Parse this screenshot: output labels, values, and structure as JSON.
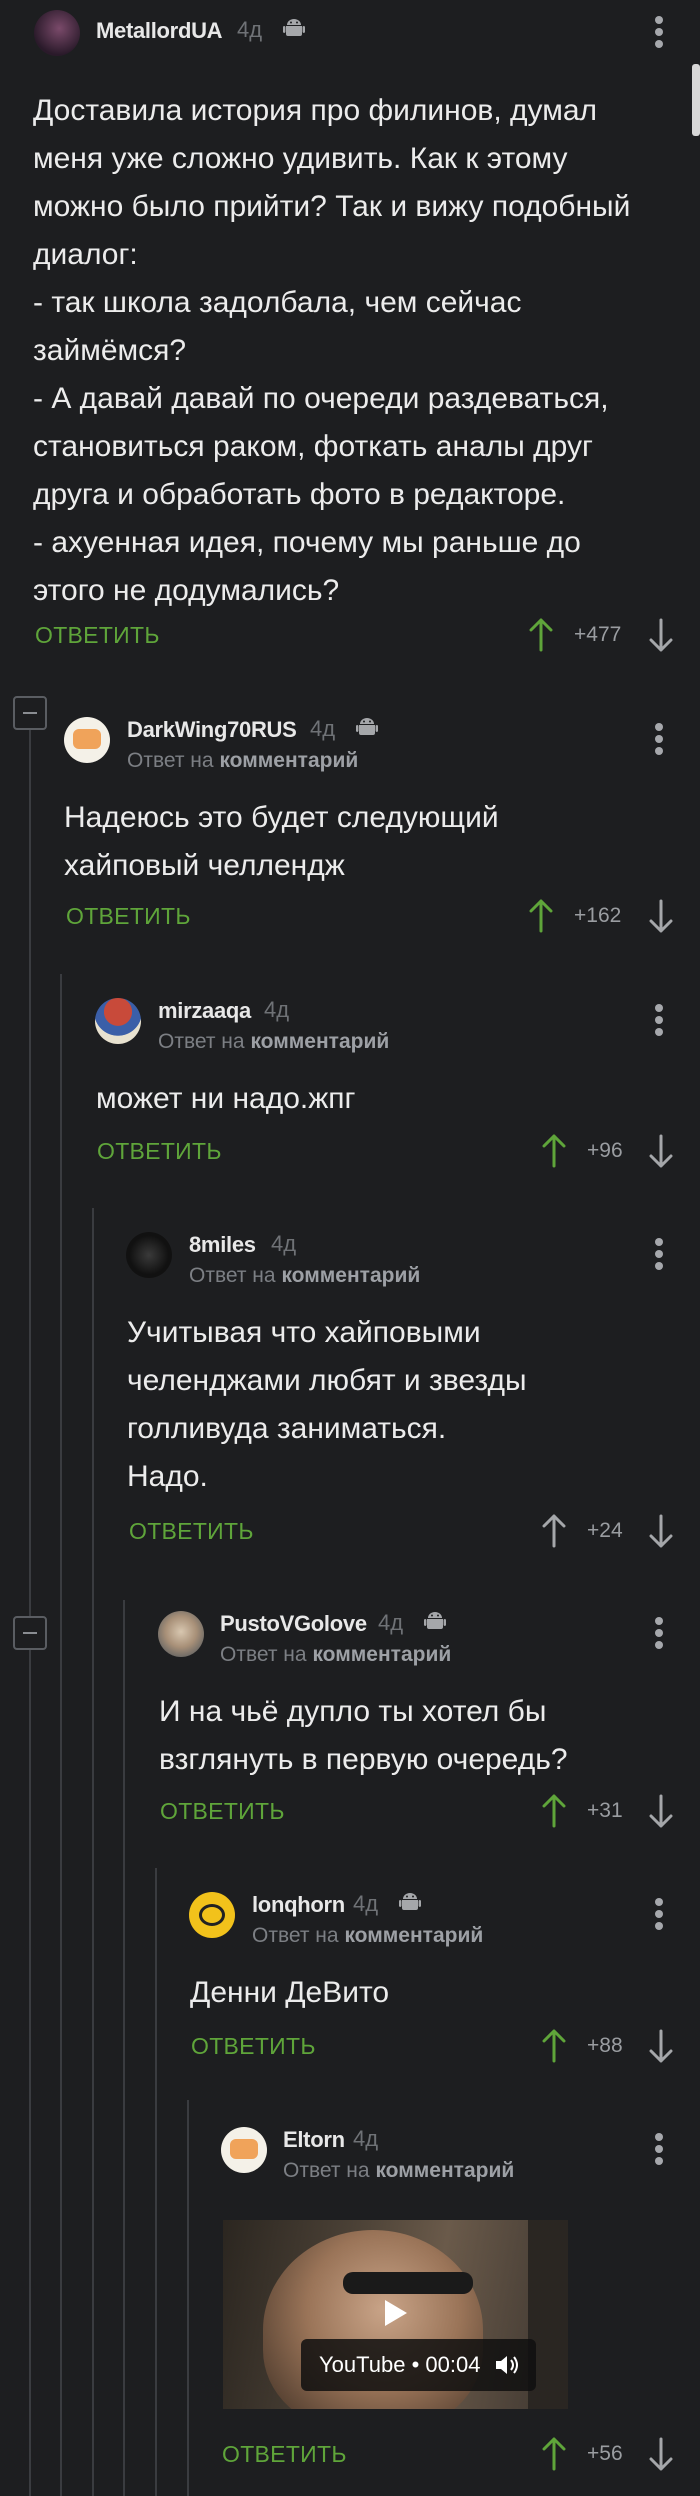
{
  "colors": {
    "background": "#1d1e20",
    "reply": "#5fa53a",
    "up": "#5fa53a",
    "text": "#ececec",
    "muted": "#7c7f84"
  },
  "comments": [
    {
      "nick": "MetallordUA",
      "time": "4д",
      "platform_icon": "android-icon",
      "text": "Доставила история про филинов, думал\nменя уже сложно удивить. Как к этому\nможно было прийти? Так и вижу подобный\nдиалог:\n- так школа задолбала, чем сейчас\nзаймёмся?\n- А давай давай по очереди раздеваться,\nстановиться раком, фоткать аналы друг\nдруга и обработать фото в редакторе.\n- ахуенная идея, почему мы раньше до\nэтого не додумались?",
      "reply": "ОТВЕТИТЬ",
      "rating": "+477"
    },
    {
      "nick": "DarkWing70RUS",
      "time": "4д",
      "platform_icon": "android-icon",
      "sub_prefix": "Ответ на",
      "sub_link": "комментарий",
      "text": "Надеюсь это будет следующий\nхайповый челлендж",
      "reply": "ОТВЕТИТЬ",
      "rating": "+162"
    },
    {
      "nick": "mirzaaqa",
      "time": "4д",
      "sub_prefix": "Ответ на",
      "sub_link": "комментарий",
      "text": "может ни надо.жпг",
      "reply": "ОТВЕТИТЬ",
      "rating": "+96"
    },
    {
      "nick": "8miles",
      "time": "4д",
      "sub_prefix": "Ответ на",
      "sub_link": "комментарий",
      "text": "Учитывая что хайповыми\nчеленджами любят и звезды\nголливуда заниматься.\nНадо.",
      "reply": "ОТВЕТИТЬ",
      "rating": "+24"
    },
    {
      "nick": "PustoVGolove",
      "time": "4д",
      "platform_icon": "android-icon",
      "sub_prefix": "Ответ на",
      "sub_link": "комментарий",
      "text": "И на чьё дупло ты хотел бы\nвзглянуть в первую очередь?",
      "reply": "ОТВЕТИТЬ",
      "rating": "+31"
    },
    {
      "nick": "lonqhorn",
      "time": "4д",
      "platform_icon": "android-icon",
      "sub_prefix": "Ответ на",
      "sub_link": "комментарий",
      "text": "Денни ДеВито",
      "reply": "ОТВЕТИТЬ",
      "rating": "+88"
    },
    {
      "nick": "Eltorn",
      "time": "4д",
      "sub_prefix": "Ответ на",
      "sub_link": "комментарий",
      "video_label": "YouTube • 00:04",
      "reply": "ОТВЕТИТЬ",
      "rating": "+56"
    }
  ]
}
